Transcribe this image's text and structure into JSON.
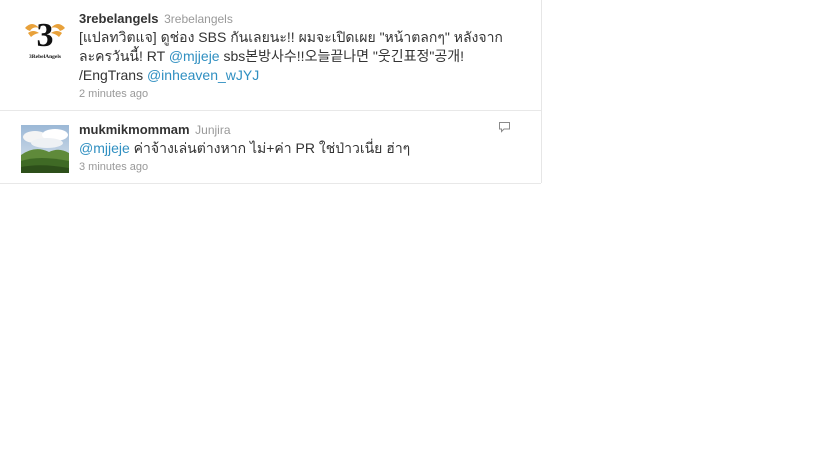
{
  "tweets": [
    {
      "screen_name": "3rebelangels",
      "full_name": "3rebelangels",
      "text_parts": {
        "t1": "[แปลทวิตแจ] ดูช่อง SBS กันเลยนะ!! ผมจะเปิดเผย \"หน้าตลกๆ\" หลังจาก ละครวันนี้! RT ",
        "m1": "@mjjeje",
        "t2": " sbs본방사수!!오늘끝나면 \"웃긴표정\"공개! /EngTrans ",
        "m2": "@inheaven_wJYJ"
      },
      "time": "2 minutes ago",
      "avatar": {
        "logo_letter": "3",
        "caption": "3RebelAngels",
        "accent": "#e8a13a"
      }
    },
    {
      "screen_name": "mukmikmommam",
      "full_name": "Junjira",
      "text_parts": {
        "m1": "@mjjeje",
        "t1": " ค่าจ้างเล่นต่างหาก ไม่+ค่า PR ใช่ป่าวเนี่ย ฮ่าๆ"
      },
      "time": "3 minutes ago",
      "reply_icon": "speech-bubble-icon"
    }
  ],
  "colors": {
    "link": "#2f8fc1",
    "text": "#333333",
    "meta": "#999999"
  }
}
